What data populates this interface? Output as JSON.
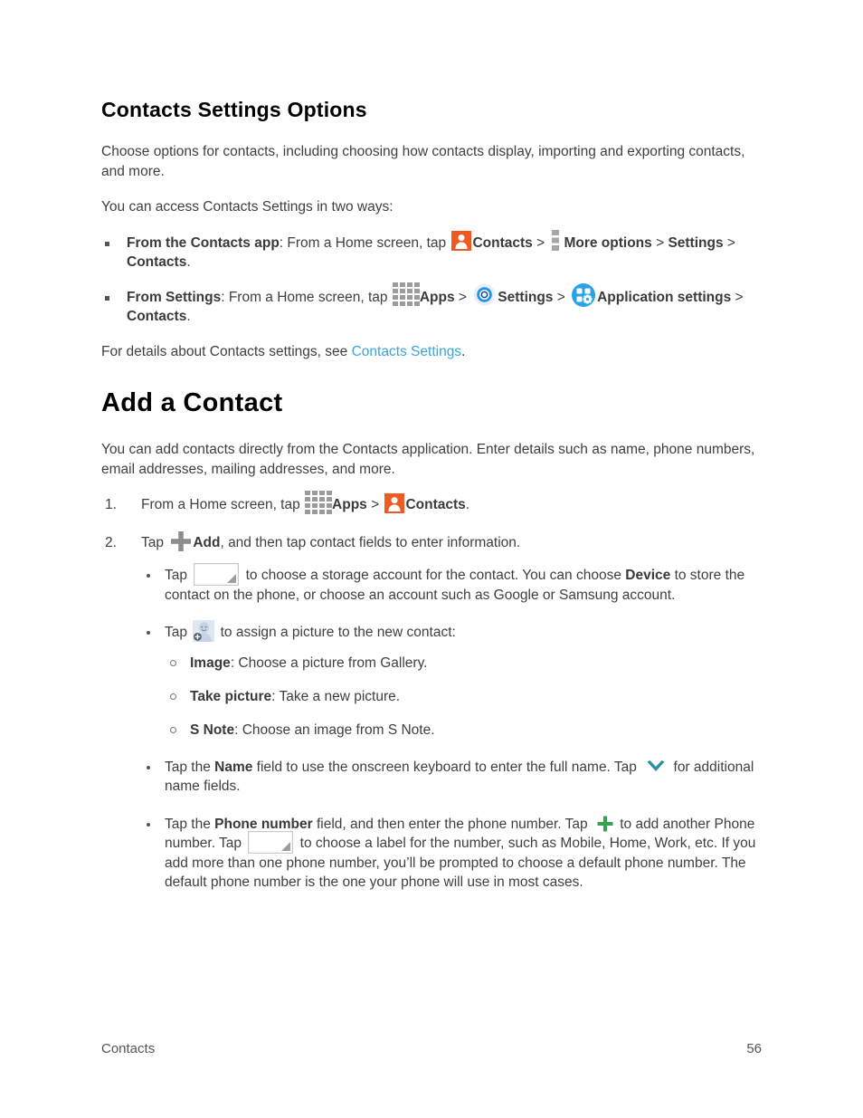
{
  "document": {
    "section_heading": "Contacts Settings Options",
    "intro_paragraph": "Choose options for contacts, including choosing how contacts display, importing and exporting contacts, and more.",
    "access_intro": "You can access Contacts Settings in two ways:",
    "access_methods": [
      {
        "label": "From the Contacts app",
        "text_1": ": From a Home screen, tap ",
        "icon_1": "contacts-icon",
        "bold_1": "Contacts",
        "sep_1": " > ",
        "icon_2": "more-options-icon",
        "bold_2": "More options",
        "sep_2": " > ",
        "bold_3": "Settings",
        "sep_3": " > ",
        "bold_4": "Contacts",
        "end": "."
      },
      {
        "label": "From Settings",
        "text_1": ": From a Home screen, tap ",
        "icon_1": "apps-grid-icon",
        "bold_1": "Apps",
        "sep_1": " > ",
        "icon_2": "settings-gear-icon",
        "bold_2": "Settings",
        "sep_2": " > ",
        "icon_3": "application-settings-icon",
        "bold_3": "Application settings",
        "sep_3": " > ",
        "bold_4": "Contacts",
        "end": "."
      }
    ],
    "details_line": {
      "before": "For details about Contacts settings, see ",
      "link_text": "Contacts Settings",
      "after": "."
    },
    "chapter_heading": "Add a Contact",
    "chapter_intro": "You can add contacts directly from the Contacts application. Enter details such as name, phone numbers, email addresses, mailing addresses, and more.",
    "steps": [
      {
        "text_1": "From a Home screen, tap ",
        "icon_1": "apps-grid-icon",
        "bold_1": "Apps",
        "sep_1": " > ",
        "icon_2": "contacts-icon",
        "bold_2": "Contacts",
        "end": "."
      },
      {
        "text_1": "Tap ",
        "icon_1": "plus-add-icon",
        "bold_1": "Add",
        "end": ", and then tap contact fields to enter information."
      }
    ],
    "step2_bullets": [
      {
        "text_1": "Tap ",
        "icon": "dropdown-selector-icon",
        "text_2": " to choose a storage account for the contact. You can choose ",
        "bold_1": "Device",
        "text_3": " to store the contact on the phone, or choose an account such as Google or Samsung account."
      },
      {
        "text_1": "Tap ",
        "icon": "contact-photo-icon",
        "text_2": " to assign a picture to the new contact:",
        "sub_items": [
          {
            "label": "Image",
            "text": ": Choose a picture from Gallery."
          },
          {
            "label": "Take picture",
            "text": ": Take a new picture."
          },
          {
            "label": "S Note",
            "text": ": Choose an image from S Note."
          }
        ]
      },
      {
        "text_1": "Tap the ",
        "bold_1": "Name",
        "text_2": " field to use the onscreen keyboard to enter the full name. Tap ",
        "icon": "chevron-down-icon",
        "text_3": " for additional name fields."
      },
      {
        "text_1": "Tap the ",
        "bold_1": "Phone number",
        "text_2": " field, and then enter the phone number. Tap ",
        "icon_1": "plus-green-icon",
        "text_3": " to add another Phone number. Tap ",
        "icon_2": "dropdown-selector-icon",
        "text_4": " to choose a label for the number, such as Mobile, Home, Work, etc. If you add more than one phone number, you’ll be prompted to choose a default phone number. The default phone number is the one your phone will use in most cases."
      }
    ],
    "footer": {
      "left": "Contacts",
      "page_number": "56"
    }
  },
  "colors": {
    "contacts_orange": "#ee5a22",
    "link_blue": "#3ba4db",
    "settings_blue": "#2196e0",
    "app_settings_blue": "#29a3e8",
    "chevron_teal": "#2b8fa3",
    "plus_green": "#35a352",
    "icon_gray": "#8a8a8a",
    "text_gray": "#3f3f3f"
  }
}
